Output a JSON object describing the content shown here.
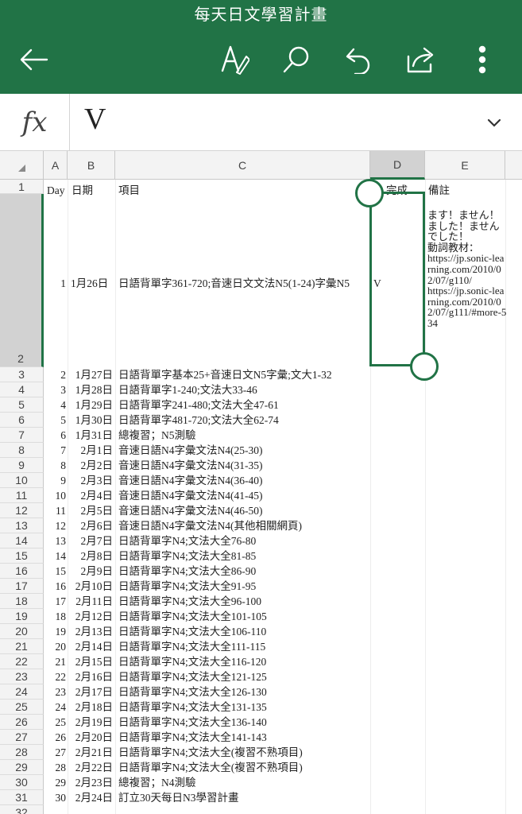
{
  "app": {
    "title": "每天日文學習計畫",
    "accent": "#217346"
  },
  "toolbar": {
    "back_icon": "back-arrow-icon",
    "format_icon": "text-format-icon",
    "search_icon": "search-icon",
    "undo_icon": "undo-icon",
    "share_icon": "share-icon",
    "more_icon": "more-vertical-icon"
  },
  "formula_bar": {
    "fx_label": "fx",
    "value": "V"
  },
  "columns": [
    "A",
    "B",
    "C",
    "D",
    "E"
  ],
  "header_row": {
    "A": "Day",
    "B": "日期",
    "C": "項目",
    "D": "完成",
    "E": "備註"
  },
  "rows": [
    {
      "row": "3",
      "day": "2",
      "date": "1月27日",
      "item": "日語背單字基本25+音速日文N5字彙;文大1-32"
    },
    {
      "row": "4",
      "day": "3",
      "date": "1月28日",
      "item": "日語背單字1-240;文法大33-46"
    },
    {
      "row": "5",
      "day": "4",
      "date": "1月29日",
      "item": "日語背單字241-480;文法大全47-61"
    },
    {
      "row": "6",
      "day": "5",
      "date": "1月30日",
      "item": "日語背單字481-720;文法大全62-74"
    },
    {
      "row": "7",
      "day": "6",
      "date": "1月31日",
      "item": "總複習；N5測驗"
    },
    {
      "row": "8",
      "day": "7",
      "date": "2月1日",
      "item": "音速日語N4字彙文法N4(25-30)"
    },
    {
      "row": "9",
      "day": "8",
      "date": "2月2日",
      "item": "音速日語N4字彙文法N4(31-35)"
    },
    {
      "row": "10",
      "day": "9",
      "date": "2月3日",
      "item": "音速日語N4字彙文法N4(36-40)"
    },
    {
      "row": "11",
      "day": "10",
      "date": "2月4日",
      "item": "音速日語N4字彙文法N4(41-45)"
    },
    {
      "row": "12",
      "day": "11",
      "date": "2月5日",
      "item": "音速日語N4字彙文法N4(46-50)"
    },
    {
      "row": "13",
      "day": "12",
      "date": "2月6日",
      "item": "音速日語N4字彙文法N4(其他相關網頁)"
    },
    {
      "row": "14",
      "day": "13",
      "date": "2月7日",
      "item": "日語背單字N4;文法大全76-80"
    },
    {
      "row": "15",
      "day": "14",
      "date": "2月8日",
      "item": "日語背單字N4;文法大全81-85"
    },
    {
      "row": "16",
      "day": "15",
      "date": "2月9日",
      "item": "日語背單字N4;文法大全86-90"
    },
    {
      "row": "17",
      "day": "16",
      "date": "2月10日",
      "item": "日語背單字N4;文法大全91-95"
    },
    {
      "row": "18",
      "day": "17",
      "date": "2月11日",
      "item": "日語背單字N4;文法大全96-100"
    },
    {
      "row": "19",
      "day": "18",
      "date": "2月12日",
      "item": "日語背單字N4;文法大全101-105"
    },
    {
      "row": "20",
      "day": "19",
      "date": "2月13日",
      "item": "日語背單字N4;文法大全106-110"
    },
    {
      "row": "21",
      "day": "20",
      "date": "2月14日",
      "item": "日語背單字N4;文法大全111-115"
    },
    {
      "row": "22",
      "day": "21",
      "date": "2月15日",
      "item": "日語背單字N4;文法大全116-120"
    },
    {
      "row": "23",
      "day": "22",
      "date": "2月16日",
      "item": "日語背單字N4;文法大全121-125"
    },
    {
      "row": "24",
      "day": "23",
      "date": "2月17日",
      "item": "日語背單字N4;文法大全126-130"
    },
    {
      "row": "25",
      "day": "24",
      "date": "2月18日",
      "item": "日語背單字N4;文法大全131-135"
    },
    {
      "row": "26",
      "day": "25",
      "date": "2月19日",
      "item": "日語背單字N4;文法大全136-140"
    },
    {
      "row": "27",
      "day": "26",
      "date": "2月20日",
      "item": "日語背單字N4;文法大全141-143"
    },
    {
      "row": "28",
      "day": "27",
      "date": "2月21日",
      "item": "日語背單字N4;文法大全(複習不熟項目)"
    },
    {
      "row": "29",
      "day": "28",
      "date": "2月22日",
      "item": "日語背單字N4;文法大全(複習不熟項目)"
    },
    {
      "row": "30",
      "day": "29",
      "date": "2月23日",
      "item": "總複習；N4測驗"
    },
    {
      "row": "31",
      "day": "30",
      "date": "2月24日",
      "item": "訂立30天每日N3學習計畫"
    },
    {
      "row": "32",
      "day": "",
      "date": "",
      "item": ""
    }
  ],
  "selected_row": {
    "row_header_top": "1",
    "row_header_bottom": "2",
    "day": "1",
    "date": "1月26日",
    "item": "日語背單字361-720;音速日文文法N5(1-24)字彙N5",
    "done": "V",
    "note": "ます！ません！ました！ませんでした！\n動詞教材：\nhttps://jp.sonic-learning.com/2010/02/07/g110/\nhttps://jp.sonic-learning.com/2010/02/07/g111/#more-534"
  }
}
